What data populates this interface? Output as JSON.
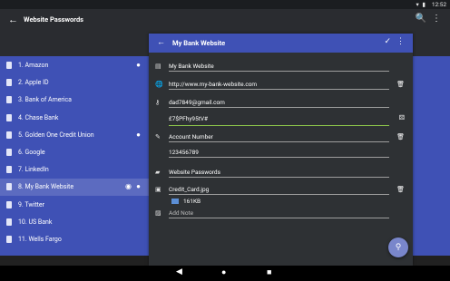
{
  "status": {
    "time": "12:52",
    "icons": "▾ ▮"
  },
  "appbar": {
    "title": "Website Passwords",
    "back": "←",
    "search": "🔍",
    "more": "⋮"
  },
  "list": [
    {
      "label": "1.  Amazon",
      "person": true
    },
    {
      "label": "2.  Apple ID"
    },
    {
      "label": "3.  Bank of America"
    },
    {
      "label": "4.  Chase Bank"
    },
    {
      "label": "5.  Golden One Credit Union",
      "person": true
    },
    {
      "label": "6.  Google"
    },
    {
      "label": "7.  LinkedIn"
    },
    {
      "label": "8.  My Bank Website",
      "person": true,
      "eye": true,
      "selected": true
    },
    {
      "label": "9.  Twitter"
    },
    {
      "label": "10.  US Bank"
    },
    {
      "label": "11.  Wells Fargo"
    }
  ],
  "detail": {
    "title": "My Bank Website",
    "name": "My Bank Website",
    "url": "http://www.my-bank-website.com",
    "username": "dad7849@gmail.com",
    "password": "£7$PFhy95tV#",
    "account_label": "Account Number",
    "account_value": "123456789",
    "folder": "Website Passwords",
    "attachment": "Credit_Card.jpg",
    "attachment_size": "161KB",
    "note_placeholder": "Add Note"
  },
  "navbar": {
    "back": "◀",
    "home": "●",
    "recent": "■"
  }
}
